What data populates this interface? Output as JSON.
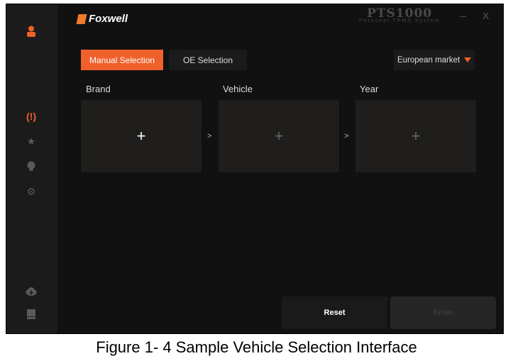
{
  "header": {
    "logo": "Foxwell",
    "product": "PTS1000",
    "product_subtitle": "Personal TPMS System",
    "minimize": "–",
    "close": "X"
  },
  "tabs": [
    {
      "label": "Manual Selection",
      "active": true
    },
    {
      "label": "OE  Selection",
      "active": false
    }
  ],
  "market": {
    "selected": "European market"
  },
  "columns": [
    {
      "label": "Brand",
      "placeholder": "+"
    },
    {
      "label": "Vehicle",
      "placeholder": "+"
    },
    {
      "label": "Year",
      "placeholder": "+"
    }
  ],
  "separator": ">",
  "buttons": {
    "reset": "Reset",
    "enter": "Enter"
  },
  "sidebar": {
    "icons": [
      "user-icon",
      "tpms-icon",
      "star-icon",
      "bulb-icon",
      "gear-icon",
      "cloud-download-icon",
      "book-icon"
    ]
  },
  "caption": "Figure 1- 4 Sample Vehicle Selection Interface",
  "colors": {
    "accent": "#f0602a",
    "background": "#111112",
    "sidebar": "#1b1b1c"
  }
}
